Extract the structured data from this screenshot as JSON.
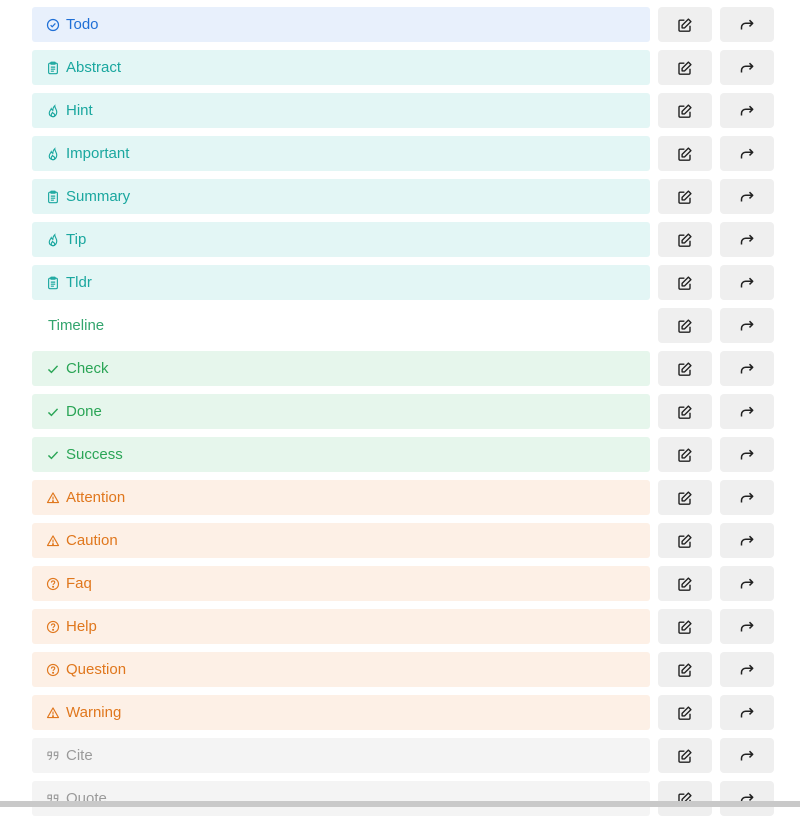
{
  "rows": [
    {
      "label": "Todo",
      "theme": "t-blue",
      "icon": "circle-check-icon",
      "color": "#1f6fd6"
    },
    {
      "label": "Abstract",
      "theme": "t-cyan",
      "icon": "clipboard-icon",
      "color": "#1aa79f"
    },
    {
      "label": "Hint",
      "theme": "t-cyan",
      "icon": "flame-icon",
      "color": "#1aa79f"
    },
    {
      "label": "Important",
      "theme": "t-cyan",
      "icon": "flame-icon",
      "color": "#1aa79f"
    },
    {
      "label": "Summary",
      "theme": "t-cyan",
      "icon": "clipboard-icon",
      "color": "#1aa79f"
    },
    {
      "label": "Tip",
      "theme": "t-cyan",
      "icon": "flame-icon",
      "color": "#1aa79f"
    },
    {
      "label": "Tldr",
      "theme": "t-cyan",
      "icon": "clipboard-icon",
      "color": "#1aa79f"
    },
    {
      "label": "Timeline",
      "theme": "t-plain",
      "icon": "",
      "color": "#33a56e"
    },
    {
      "label": "Check",
      "theme": "t-green",
      "icon": "checkmark-icon",
      "color": "#2aa556"
    },
    {
      "label": "Done",
      "theme": "t-green",
      "icon": "checkmark-icon",
      "color": "#2aa556"
    },
    {
      "label": "Success",
      "theme": "t-green",
      "icon": "checkmark-icon",
      "color": "#2aa556"
    },
    {
      "label": "Attention",
      "theme": "t-orange",
      "icon": "warning-triangle-icon",
      "color": "#e0771d"
    },
    {
      "label": "Caution",
      "theme": "t-orange",
      "icon": "warning-triangle-icon",
      "color": "#e0771d"
    },
    {
      "label": "Faq",
      "theme": "t-orange",
      "icon": "question-circle-icon",
      "color": "#e0771d"
    },
    {
      "label": "Help",
      "theme": "t-orange",
      "icon": "question-circle-icon",
      "color": "#e0771d"
    },
    {
      "label": "Question",
      "theme": "t-orange",
      "icon": "question-circle-icon",
      "color": "#e0771d"
    },
    {
      "label": "Warning",
      "theme": "t-orange",
      "icon": "warning-triangle-icon",
      "color": "#e0771d"
    },
    {
      "label": "Cite",
      "theme": "t-gray",
      "icon": "quote-icon",
      "color": "#9a9a9a"
    },
    {
      "label": "Quote",
      "theme": "t-gray",
      "icon": "quote-icon",
      "color": "#9a9a9a"
    }
  ],
  "actions": {
    "edit_icon": "edit-icon",
    "go_icon": "forward-arrow-icon"
  }
}
